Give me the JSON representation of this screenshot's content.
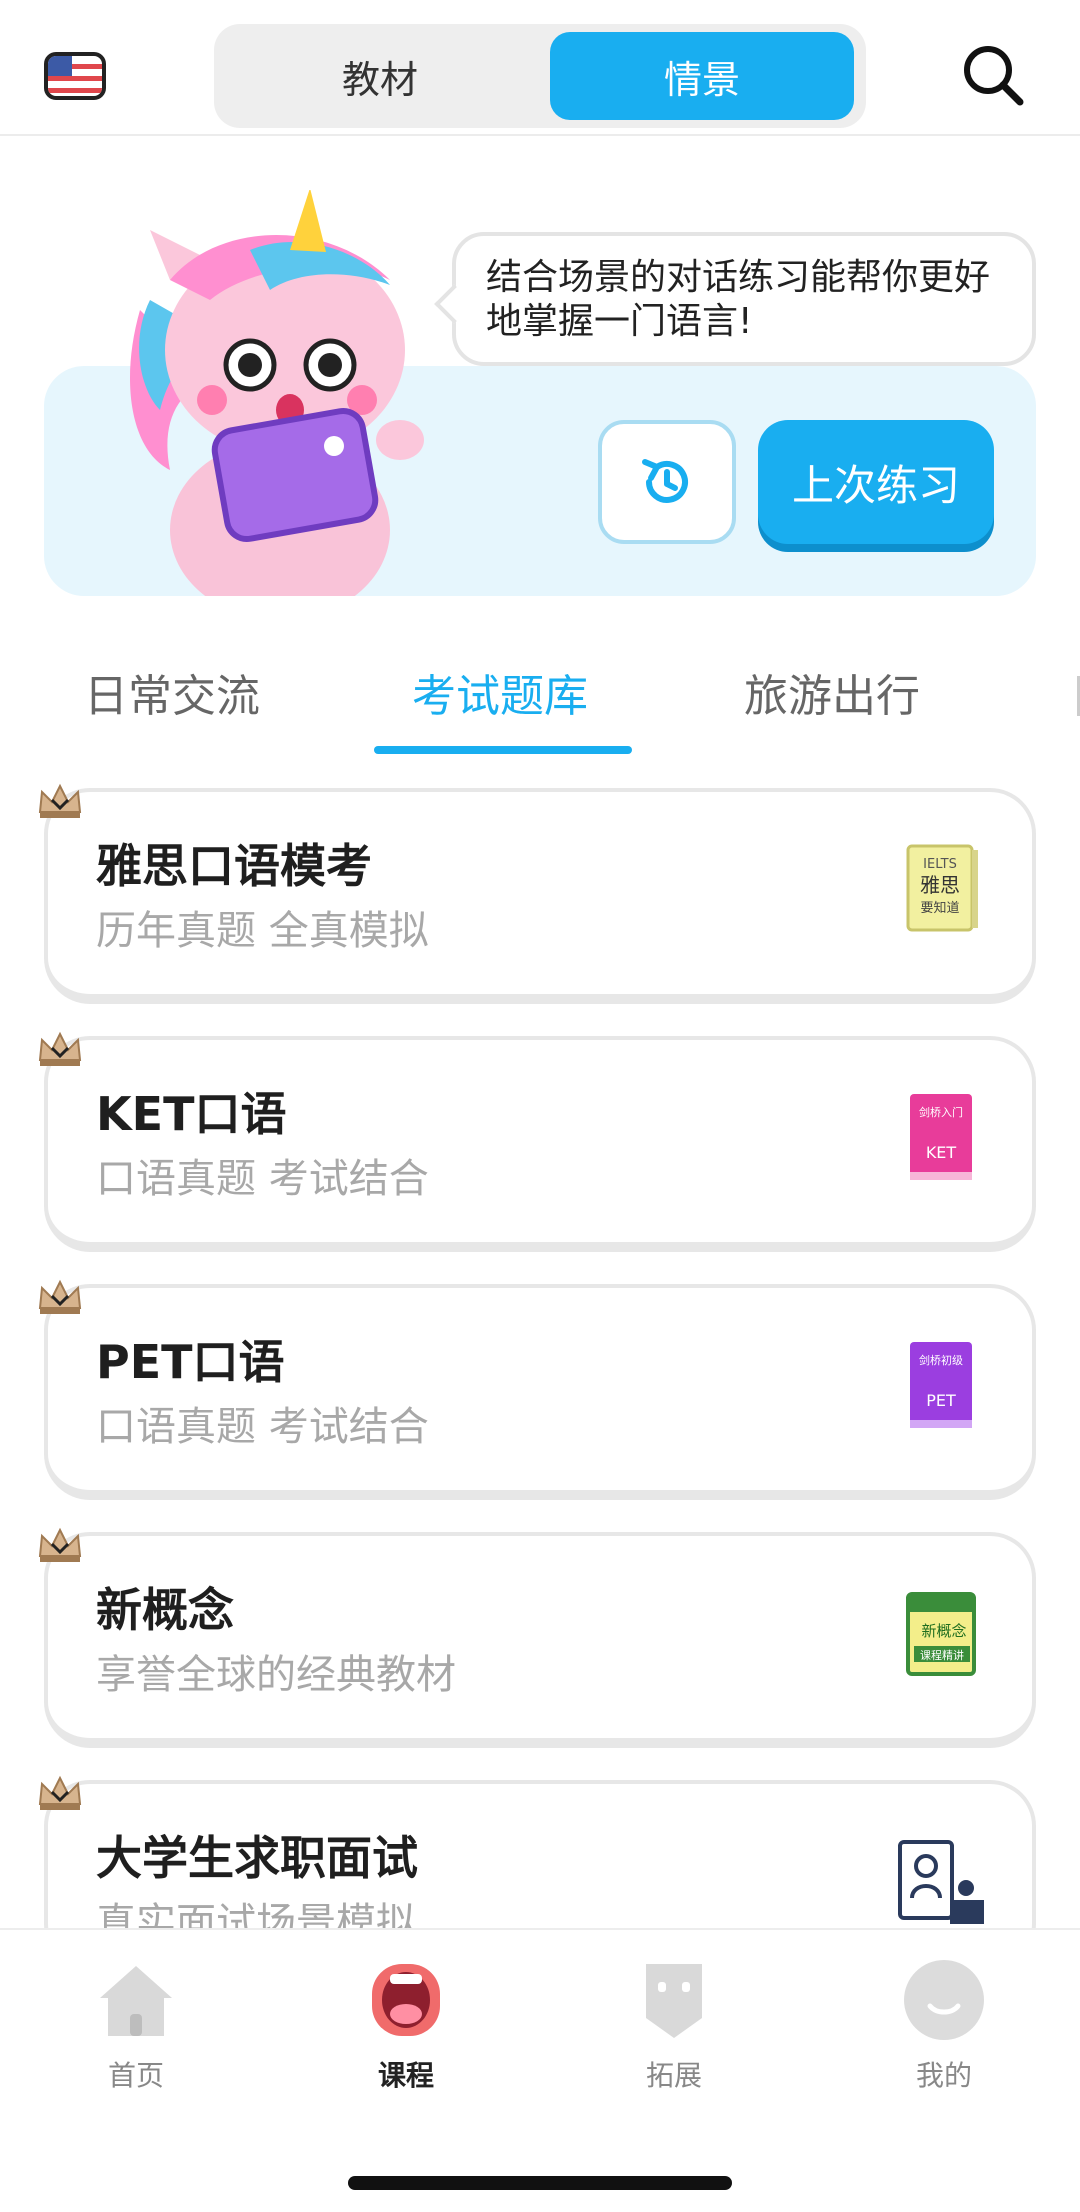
{
  "header": {
    "segment": {
      "left_label": "教材",
      "right_label": "情景",
      "active": "情景"
    },
    "icons": {
      "language_flag": "us-flag-icon",
      "search": "search-icon"
    }
  },
  "hero": {
    "bubble_text": "结合场景的对话练习能帮你更好地掌握一门语言!",
    "history_icon": "history-clock-icon",
    "last_practice_label": "上次练习"
  },
  "tabs": [
    {
      "label": "日常交流",
      "active": false
    },
    {
      "label": "考试题库",
      "active": true
    },
    {
      "label": "旅游出行",
      "active": false
    }
  ],
  "cards": [
    {
      "title": "雅思口语模考",
      "subtitle": "历年真题 全真模拟",
      "icon": "ielts-book-icon",
      "book_text": "IELTS 雅思 要知道"
    },
    {
      "title": "KET口语",
      "subtitle": "口语真题 考试结合",
      "icon": "ket-book-icon",
      "book_text": "剑桥入门 KET"
    },
    {
      "title": "PET口语",
      "subtitle": "口语真题 考试结合",
      "icon": "pet-book-icon",
      "book_text": "剑桥初级 PET"
    },
    {
      "title": "新概念",
      "subtitle": "享誉全球的经典教材",
      "icon": "new-concept-book-icon",
      "book_text": "新概念 课程精讲"
    },
    {
      "title": "大学生求职面试",
      "subtitle": "真实面试场景模拟",
      "icon": "interview-icon"
    }
  ],
  "bottom_nav": [
    {
      "label": "首页",
      "icon": "home-icon",
      "active": false
    },
    {
      "label": "课程",
      "icon": "course-mouth-icon",
      "active": true
    },
    {
      "label": "拓展",
      "icon": "expand-icon",
      "active": false
    },
    {
      "label": "我的",
      "icon": "profile-icon",
      "active": false
    }
  ],
  "colors": {
    "accent": "#19aef0",
    "muted_text": "#a8a8a8",
    "hero_bg": "#e6f6fd",
    "crown": "#c9a27a"
  }
}
